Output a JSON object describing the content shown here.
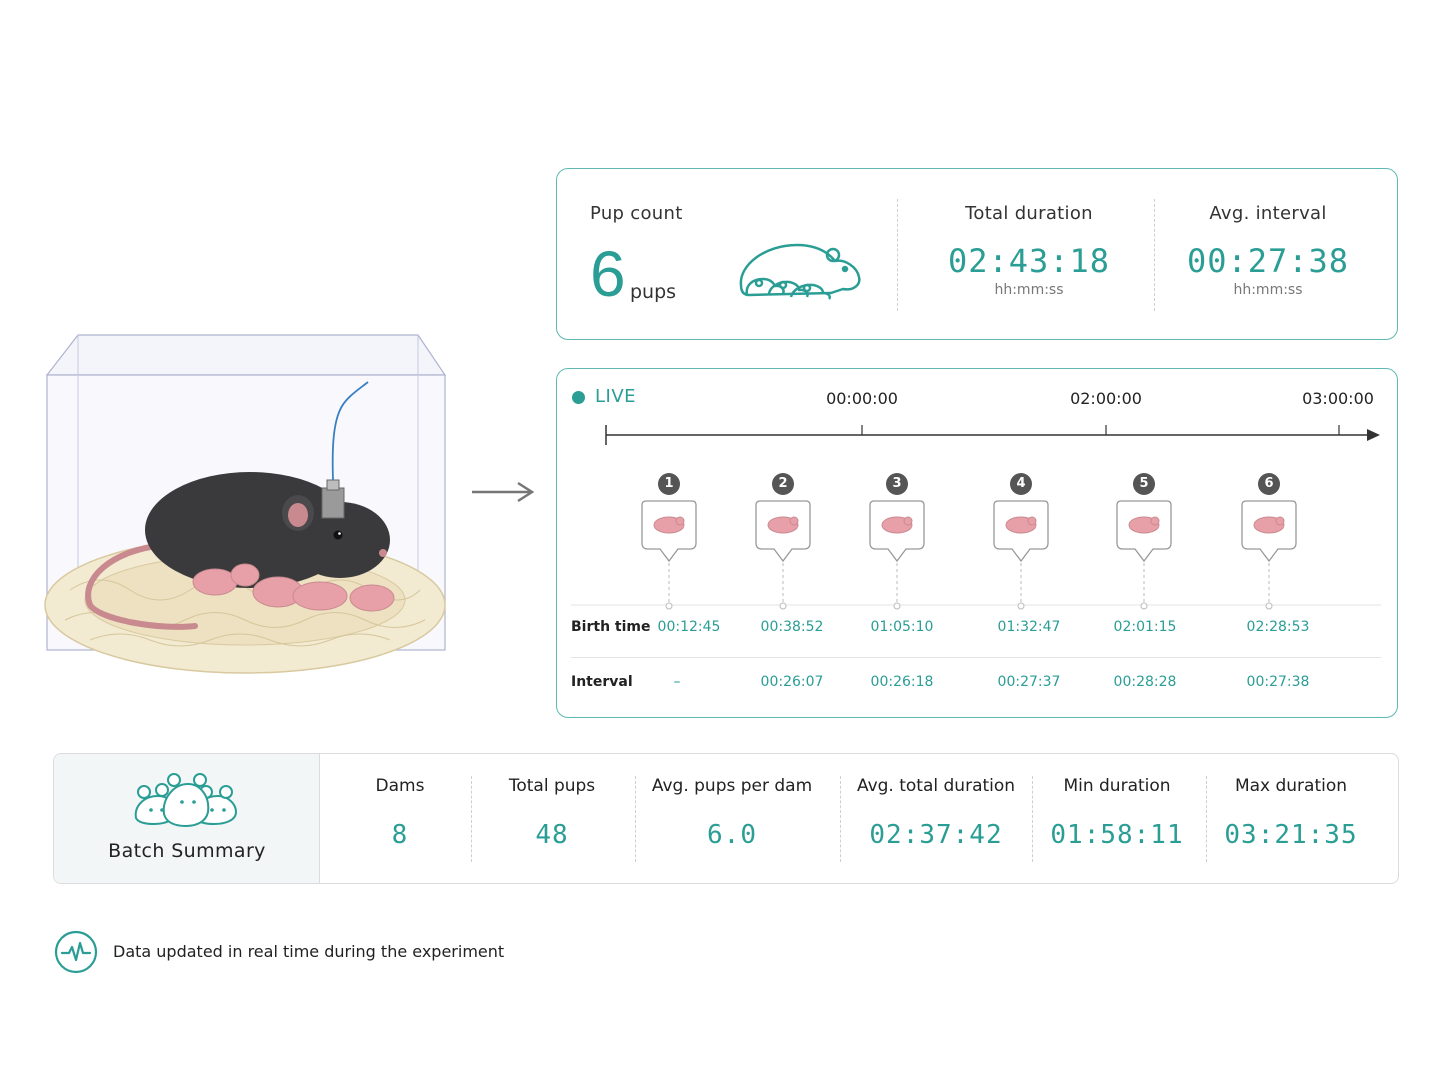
{
  "stats": {
    "pup_count": {
      "label": "Pup count",
      "value": "6",
      "unit": "pups"
    },
    "total_duration": {
      "label": "Total duration",
      "value": "02:43:18",
      "unit": "hh:mm:ss"
    },
    "avg_interval": {
      "label": "Avg. interval",
      "value": "00:27:38",
      "unit": "hh:mm:ss"
    }
  },
  "timeline": {
    "live_label": "LIVE",
    "ticks": [
      "00:00:00",
      "02:00:00",
      "03:00:00"
    ],
    "row_labels": {
      "birth": "Birth time",
      "interval": "Interval"
    },
    "pups": [
      {
        "num": "1",
        "birth": "00:12:45",
        "interval": "–"
      },
      {
        "num": "2",
        "birth": "00:38:52",
        "interval": "00:26:07"
      },
      {
        "num": "3",
        "birth": "01:05:10",
        "interval": "00:26:18"
      },
      {
        "num": "4",
        "birth": "01:32:47",
        "interval": "00:27:37"
      },
      {
        "num": "5",
        "birth": "02:01:15",
        "interval": "00:28:28"
      },
      {
        "num": "6",
        "birth": "02:28:53",
        "interval": "00:27:38"
      }
    ]
  },
  "batch": {
    "title": "Batch Summary",
    "metrics": [
      {
        "label": "Dams",
        "value": "8"
      },
      {
        "label": "Total pups",
        "value": "48"
      },
      {
        "label": "Avg. pups per dam",
        "value": "6.0"
      },
      {
        "label": "Avg. total duration",
        "value": "02:37:42"
      },
      {
        "label": "Min duration",
        "value": "01:58:11"
      },
      {
        "label": "Max duration",
        "value": "03:21:35"
      }
    ]
  },
  "footer": {
    "text": "Data updated in real time during the experiment"
  },
  "colors": {
    "accent": "#2a9d95",
    "border": "#5fb9b2",
    "pup_pink": "#e8a0a8",
    "mouse_dark": "#3a3a3c"
  }
}
